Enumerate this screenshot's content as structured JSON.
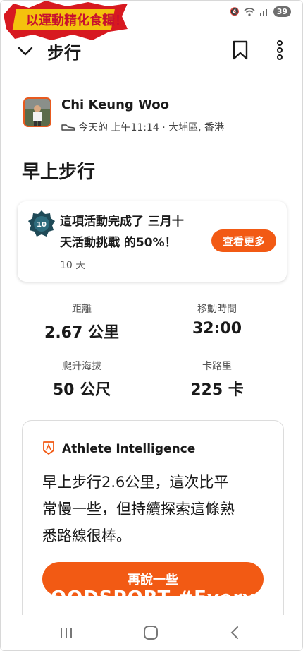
{
  "logo": {
    "text": "以運動精化食糧！"
  },
  "status": {
    "battery": "39"
  },
  "nav": {
    "title": "步行"
  },
  "athlete": {
    "name": "Chi Keung Woo",
    "meta": "今天的 上午11:14 · 大埔區, 香港"
  },
  "activity": {
    "title": "早上步行"
  },
  "challenge": {
    "line1": "這項活動完成了 三月十",
    "line2": "天活動挑戰 的50%！",
    "sub": "10 天",
    "button": "查看更多",
    "badge_number": "10"
  },
  "stats": [
    {
      "label": "距離",
      "value": "2.67 公里"
    },
    {
      "label": "移動時間",
      "value": "32:00"
    },
    {
      "label": "爬升海拔",
      "value": "50 公尺"
    },
    {
      "label": "卡路里",
      "value": "225 卡"
    }
  ],
  "ai": {
    "header": "Athlete Intelligence",
    "line1": "早上步行2.6公里，這次比平",
    "line2": "常慢一些，但持續探索這條熟",
    "line3": "悉路線很棒。",
    "button": "再說一些",
    "watermark": "OODSPORT #Everyd"
  },
  "colors": {
    "accent": "#f25a14"
  }
}
